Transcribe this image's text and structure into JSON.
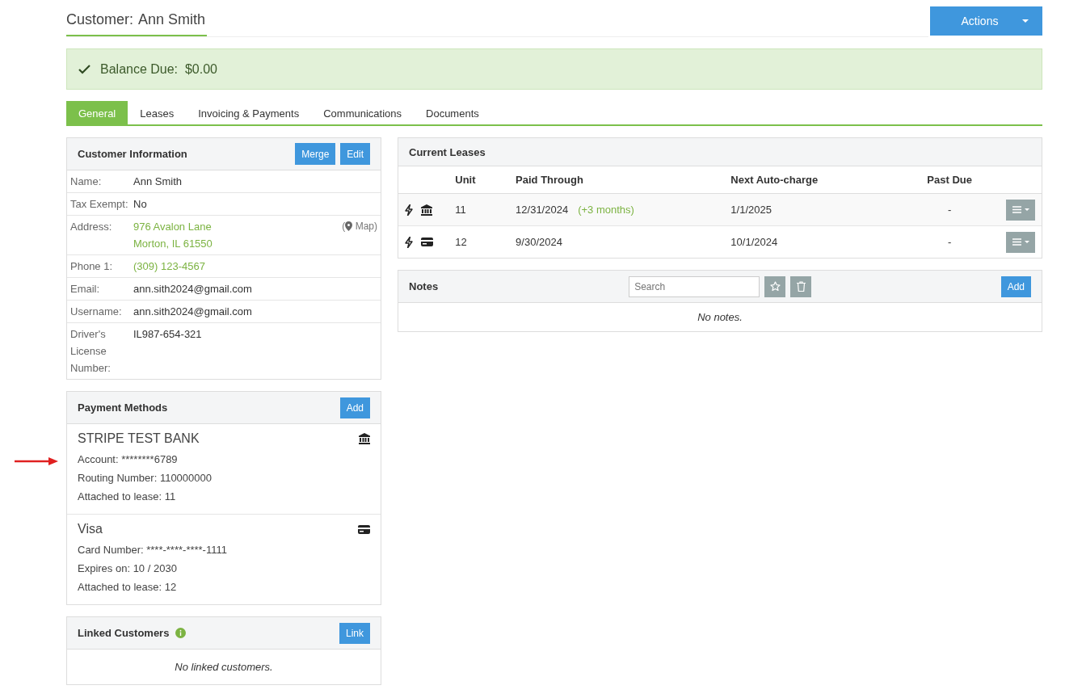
{
  "header": {
    "title_label": "Customer:",
    "title_name": "Ann Smith",
    "actions_button": "Actions"
  },
  "balance": {
    "paid": true,
    "label": "Balance Due:",
    "amount": "$0.00"
  },
  "tabs": [
    {
      "label": "General",
      "selected": true
    },
    {
      "label": "Leases",
      "selected": false
    },
    {
      "label": "Invoicing & Payments",
      "selected": false
    },
    {
      "label": "Communications",
      "selected": false
    },
    {
      "label": "Documents",
      "selected": false
    }
  ],
  "customer_info": {
    "title": "Customer Information",
    "buttons": [
      "Merge",
      "Edit"
    ],
    "fields": [
      {
        "kind": "text",
        "label": "Name:",
        "value": [
          "Ann Smith"
        ]
      },
      {
        "kind": "text",
        "label": "Tax Exempt:",
        "value": [
          "No"
        ]
      },
      {
        "kind": "address",
        "label": "Address:",
        "value": [
          "976 Avalon Lane",
          "Morton, IL 61550"
        ],
        "map_link": "( Map)"
      },
      {
        "kind": "link",
        "label": "Phone 1:",
        "value": [
          "(309) 123-4567"
        ]
      },
      {
        "kind": "text",
        "label": "Email:",
        "value": [
          "ann.sith2024@gmail.com"
        ]
      },
      {
        "kind": "text",
        "label": "Username:",
        "value": [
          "ann.sith2024@gmail.com"
        ]
      },
      {
        "kind": "text",
        "label": "Driver's License Number:",
        "value": [
          "IL987-654-321"
        ]
      }
    ]
  },
  "payment_methods": {
    "title": "Payment Methods",
    "add_button": "Add",
    "methods": [
      {
        "kind": "bank",
        "name": "STRIPE TEST BANK",
        "lines": [
          "Account: ********6789",
          "Routing Number: 110000000",
          "Attached to lease: 11"
        ]
      },
      {
        "kind": "card",
        "name": "Visa",
        "lines": [
          "Card Number: ****-****-****-1111",
          "Expires on: 10 / 2030",
          "Attached to lease: 12"
        ]
      }
    ]
  },
  "linked_customers": {
    "title": "Linked Customers",
    "link_button": "Link",
    "empty_text": "No linked customers."
  },
  "current_leases": {
    "title": "Current Leases",
    "columns": [
      "Unit",
      "Paid Through",
      "Next Auto-charge",
      "Past Due"
    ],
    "rows": [
      {
        "kind": "bank",
        "unit": "11",
        "paid_through": "12/31/2024",
        "paid_ahead": "(+3 months)",
        "next_autocharge": "1/1/2025",
        "past_due": "-"
      },
      {
        "kind": "card",
        "unit": "12",
        "paid_through": "9/30/2024",
        "next_autocharge": "10/1/2024",
        "past_due": "-"
      }
    ]
  },
  "notes": {
    "title": "Notes",
    "search_placeholder": "Search",
    "add_button": "Add",
    "empty_text": "No notes."
  }
}
